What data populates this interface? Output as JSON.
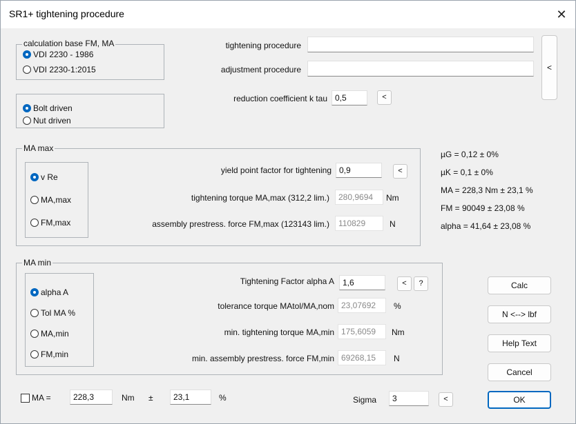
{
  "window": {
    "title": "SR1+  tightening procedure",
    "close_glyph": "✕"
  },
  "calc_base": {
    "title": "calculation base FM, MA",
    "options": [
      {
        "label": "VDI 2230 - 1986",
        "selected": true
      },
      {
        "label": "VDI 2230-1:2015",
        "selected": false
      }
    ]
  },
  "drive": {
    "options": [
      {
        "label": "Bolt driven",
        "selected": true
      },
      {
        "label": "Nut driven",
        "selected": false
      }
    ]
  },
  "procedure": {
    "tightening_label": "tightening procedure",
    "tightening_value": "",
    "adjustment_label": "adjustment procedure",
    "adjustment_value": "",
    "side_button": "<"
  },
  "reduction": {
    "label": "reduction coefficient k tau",
    "value": "0,5",
    "button": "<"
  },
  "ma_max": {
    "title": "MA max",
    "options": [
      {
        "label": "v Re",
        "selected": true
      },
      {
        "label": "MA,max",
        "selected": false
      },
      {
        "label": "FM,max",
        "selected": false
      }
    ],
    "yield_label": "yield point factor for tightening",
    "yield_value": "0,9",
    "yield_button": "<",
    "torque_label": "tightening torque MA,max (312,2 lim.)",
    "torque_value": "280,9694",
    "torque_unit": "Nm",
    "force_label": "assembly prestress. force FM,max (123143 lim.)",
    "force_value": "110829",
    "force_unit": "N"
  },
  "results": [
    "µG = 0,12 ± 0%",
    "µK = 0,1 ± 0%",
    "MA = 228,3 Nm ± 23,1 %",
    "FM = 90049 ± 23,08 %",
    "alpha = 41,64 ± 23,08 %"
  ],
  "ma_min": {
    "title": "MA min",
    "options": [
      {
        "label": "alpha A",
        "selected": true
      },
      {
        "label": "Tol MA %",
        "selected": false
      },
      {
        "label": "MA,min",
        "selected": false
      },
      {
        "label": "FM,min",
        "selected": false
      }
    ],
    "alpha_label": "Tightening Factor alpha A",
    "alpha_value": "1,6",
    "alpha_button": "<",
    "help_button": "?",
    "tol_label": "tolerance torque  MAtol/MA,nom",
    "tol_value": "23,07692",
    "tol_unit": "%",
    "mintorque_label": "min. tightening torque MA,min",
    "mintorque_value": "175,6059",
    "mintorque_unit": "Nm",
    "minforce_label": "min. assembly prestress. force FM,min",
    "minforce_value": "69268,15",
    "minforce_unit": "N"
  },
  "buttons": {
    "calc": "Calc",
    "units": "N <--> lbf",
    "help": "Help Text",
    "cancel": "Cancel",
    "ok": "OK"
  },
  "bottom": {
    "ma_checked": false,
    "ma_label": "MA =",
    "ma_value": "228,3",
    "ma_unit": "Nm",
    "pm": "±",
    "tol_value": "23,1",
    "tol_unit": "%",
    "sigma_label": "Sigma",
    "sigma_value": "3",
    "sigma_button": "<"
  }
}
